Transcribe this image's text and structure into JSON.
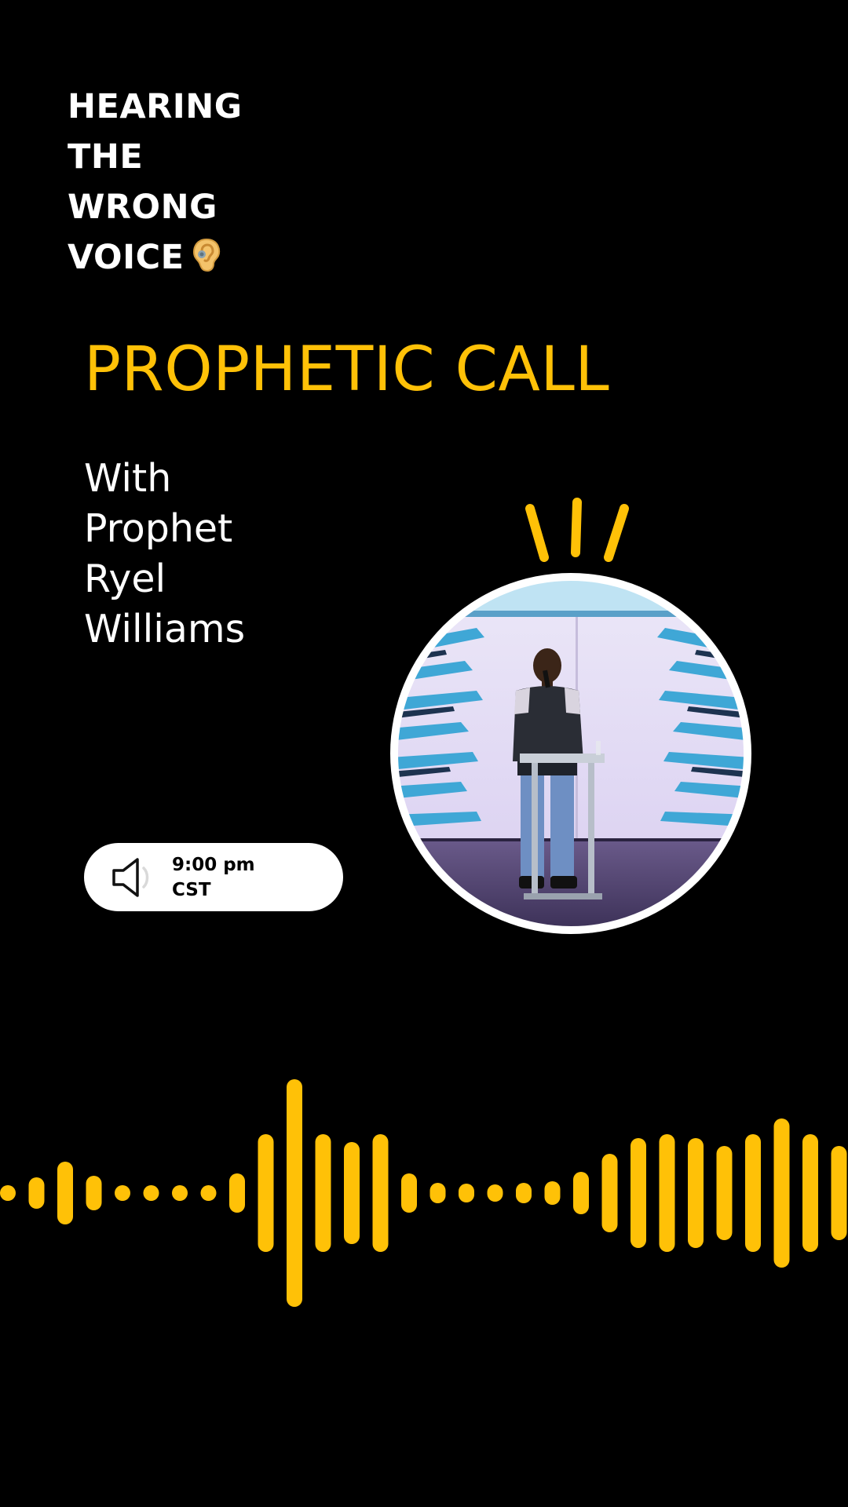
{
  "tagline": {
    "lines": [
      "HEARING",
      "THE",
      "WRONG",
      "VOICE"
    ],
    "icon": "ear-icon"
  },
  "title": "PROPHETIC CALL",
  "host": {
    "lines": [
      "With",
      "Prophet",
      "Ryel",
      "Williams"
    ]
  },
  "time": {
    "line1": "9:00 pm",
    "line2": "CST",
    "icon": "speaker-icon"
  },
  "colors": {
    "background": "#000000",
    "accent": "#FFC107",
    "text": "#FFFFFF"
  }
}
